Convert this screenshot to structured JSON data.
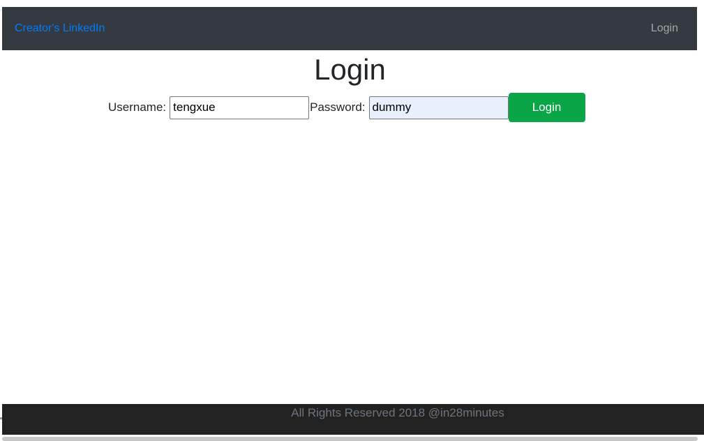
{
  "navbar": {
    "brand_link": "Creator's LinkedIn",
    "login_link": "Login"
  },
  "page": {
    "title": "Login"
  },
  "form": {
    "username_label": "Username:",
    "username_value": "tengxue",
    "password_label": "Password:",
    "password_value": "dummy",
    "submit_label": "Login"
  },
  "footer": {
    "text": "All Rights Reserved 2018 @in28minutes"
  },
  "colors": {
    "navbar_bg": "#343a40",
    "brand_link": "#007bff",
    "login_button": "#0aa547",
    "footer_bg": "#222222",
    "autofill_bg": "#e8f0fe"
  }
}
